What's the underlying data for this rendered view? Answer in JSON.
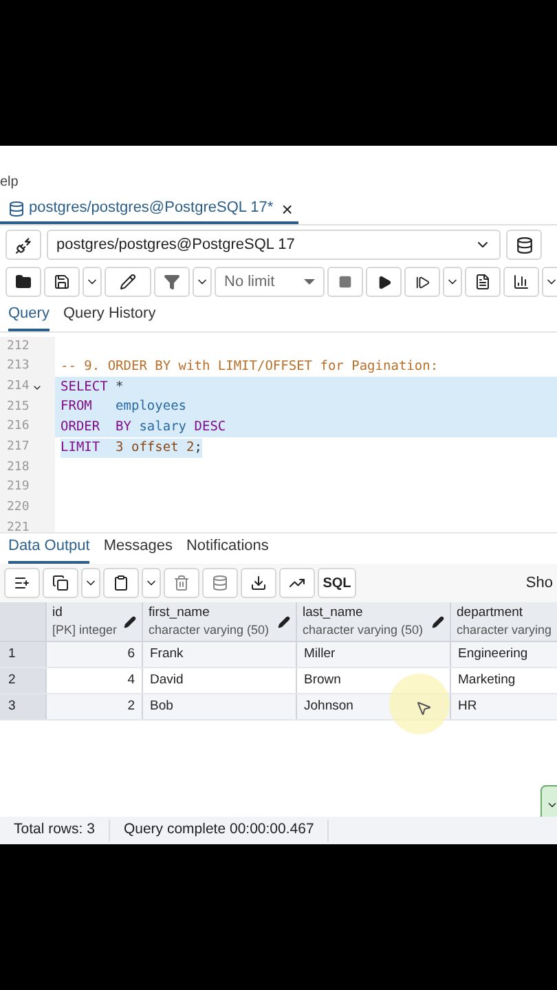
{
  "menu": {
    "item": "elp"
  },
  "editor_tab": {
    "title": "postgres/postgres@PostgreSQL 17*",
    "close": "×"
  },
  "connection": {
    "value": "postgres/postgres@PostgreSQL 17"
  },
  "toolbar": {
    "limit": "No limit"
  },
  "query_tabs": [
    {
      "label": "Query",
      "selected": true
    },
    {
      "label": "Query History",
      "selected": false
    }
  ],
  "code_lines": [
    {
      "number": "212",
      "selected": false
    },
    {
      "number": "213",
      "selected": false,
      "segments": [
        {
          "kind": "comment",
          "text": "-- 9. ORDER BY with LIMIT/OFFSET for Pagination:"
        }
      ]
    },
    {
      "number": "214",
      "fold": true,
      "selected": true,
      "full_width": true,
      "segments": [
        {
          "kind": "keyword",
          "text": "SELECT"
        },
        {
          "kind": "plain",
          "text": " *"
        }
      ]
    },
    {
      "number": "215",
      "selected": true,
      "full_width": true,
      "segments": [
        {
          "kind": "keyword",
          "text": "FROM"
        },
        {
          "kind": "ident",
          "text": "   employees"
        }
      ]
    },
    {
      "number": "216",
      "selected": true,
      "full_width": true,
      "segments": [
        {
          "kind": "keyword",
          "text": "ORDER  BY"
        },
        {
          "kind": "ident",
          "text": " salary"
        },
        {
          "kind": "keyword",
          "text": " DESC"
        }
      ]
    },
    {
      "number": "217",
      "selected": true,
      "full_width": false,
      "segments": [
        {
          "kind": "keyword",
          "text": "LIMIT"
        },
        {
          "kind": "number",
          "text": "  3 offset 2"
        },
        {
          "kind": "plain",
          "text": ";"
        }
      ]
    },
    {
      "number": "218",
      "selected": false
    },
    {
      "number": "219",
      "selected": false
    },
    {
      "number": "220",
      "selected": false
    },
    {
      "number": "221",
      "selected": false
    }
  ],
  "output_tabs": [
    {
      "label": "Data Output",
      "selected": true
    },
    {
      "label": "Messages",
      "selected": false
    },
    {
      "label": "Notifications",
      "selected": false
    }
  ],
  "grid_toolbar": {
    "sql": "SQL",
    "cut_text": "Sho"
  },
  "table": {
    "columns": [
      {
        "name": "id",
        "type": "[PK] integer"
      },
      {
        "name": "first_name",
        "type": "character varying (50)"
      },
      {
        "name": "last_name",
        "type": "character varying (50)"
      },
      {
        "name": "department",
        "type": "character varying"
      }
    ],
    "rows": [
      {
        "number": "1",
        "cells": [
          "6",
          "Frank",
          "Miller",
          "Engineering"
        ]
      },
      {
        "number": "2",
        "cells": [
          "4",
          "David",
          "Brown",
          "Marketing"
        ]
      },
      {
        "number": "3",
        "cells": [
          "2",
          "Bob",
          "Johnson",
          "HR"
        ]
      }
    ]
  },
  "status_bar": {
    "total": "Total rows: 3",
    "message": "Query complete 00:00:00.467"
  }
}
